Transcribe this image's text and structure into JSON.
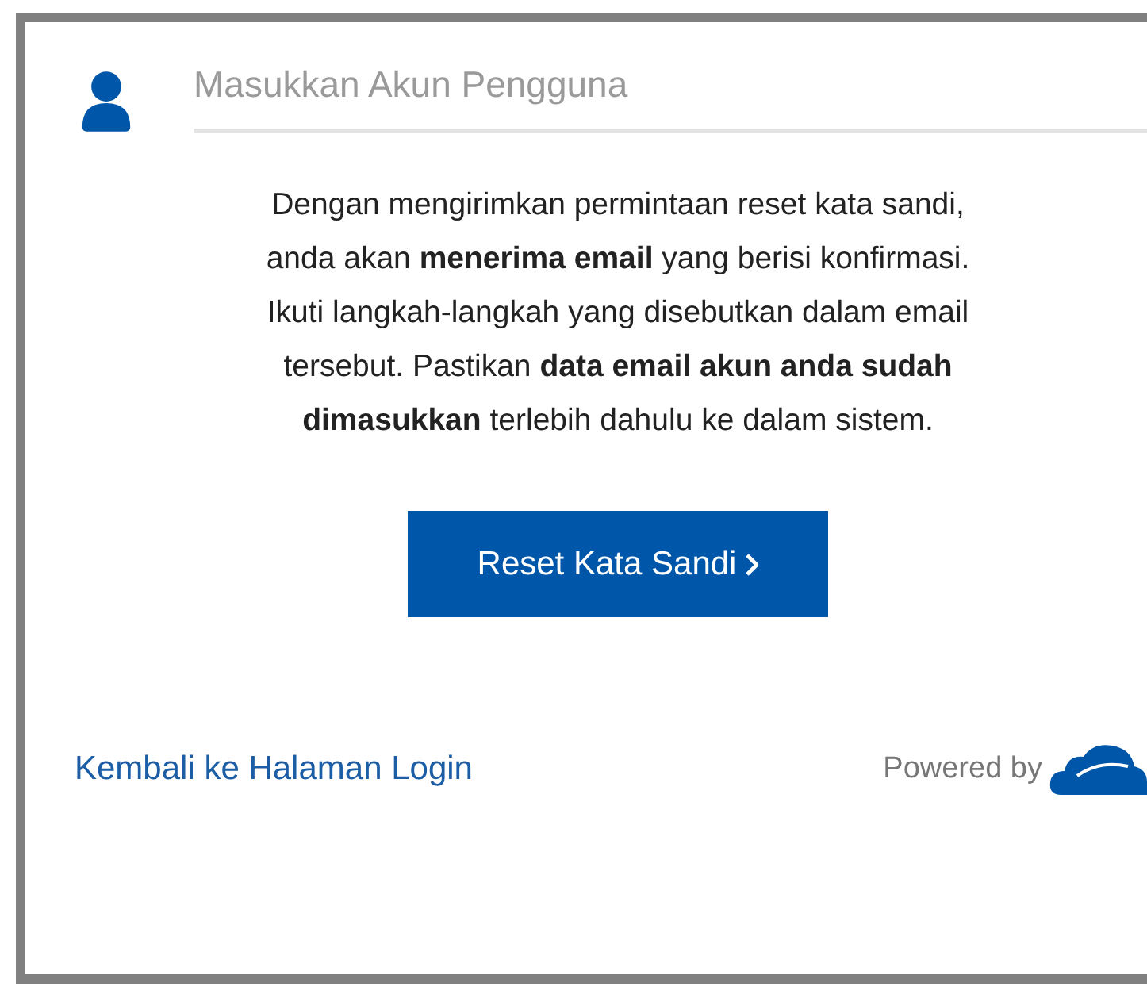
{
  "username_field": {
    "placeholder": "Masukkan Akun Pengguna"
  },
  "notice": "Dengan mengirimkan permintaan reset kata sandi,\nanda akan **menerima email** yang berisi konfirmasi.\nIkuti langkah-langkah yang disebutkan dalam email\ntersebut. Pastikan **data email akun anda sudah\ndimasukkan** terlebih dahulu ke dalam sistem.",
  "reset_button": {
    "label": "Reset Kata Sandi"
  },
  "back_link": "Kembali ke Halaman Login",
  "powered_by": "Powered by"
}
